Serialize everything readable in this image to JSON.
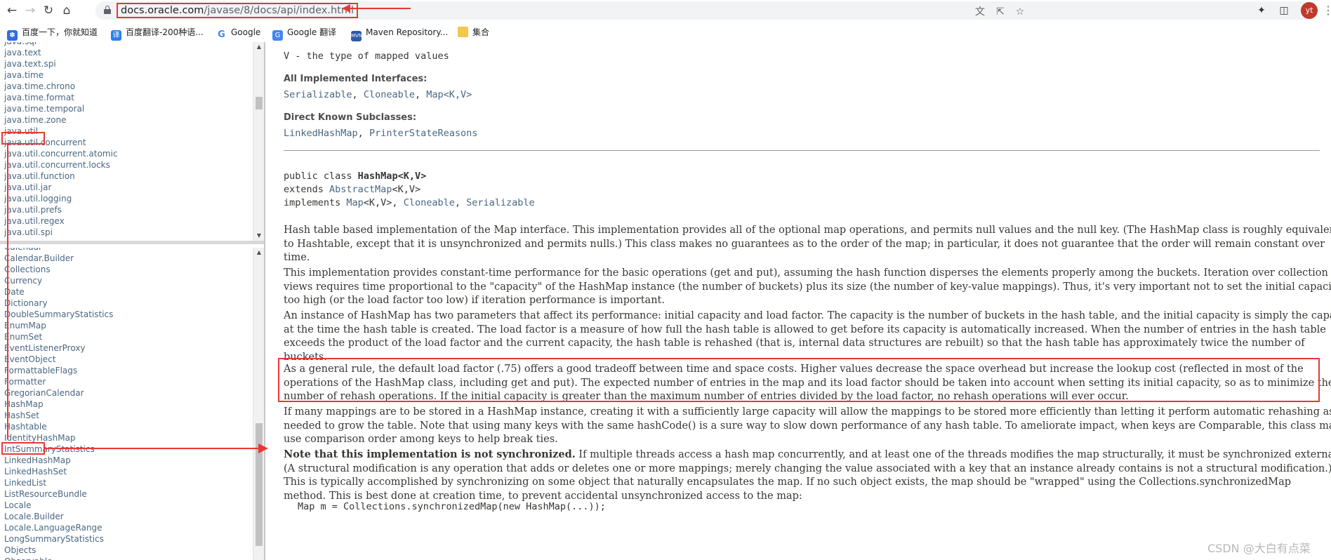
{
  "browser": {
    "url_host": "docs.oracle.com",
    "url_path": "/javase/8/docs/api/index.html",
    "avatar_initials": "yt",
    "bookmarks": [
      {
        "label": "百度一下，你就知道",
        "icon": "baidu-paw-icon",
        "color": "#2b6de6"
      },
      {
        "label": "百度翻译-200种语...",
        "icon": "baidu-translate-icon",
        "color": "#2b7ef0"
      },
      {
        "label": "Google",
        "icon": "google-g-icon",
        "color": "#4285f4"
      },
      {
        "label": "Google 翻译",
        "icon": "google-translate-icon",
        "color": "#4285f4"
      },
      {
        "label": "Maven Repository...",
        "icon": "mvn-icon",
        "color": "#2f5aa8"
      },
      {
        "label": "集合",
        "icon": "folder-icon",
        "color": "#f3c74b"
      }
    ]
  },
  "packages_frame": {
    "items": [
      "java.sql",
      "java.text",
      "java.text.spi",
      "java.time",
      "java.time.chrono",
      "java.time.format",
      "java.time.temporal",
      "java.time.zone",
      "java.util",
      "java.util.concurrent",
      "java.util.concurrent.atomic",
      "java.util.concurrent.locks",
      "java.util.function",
      "java.util.jar",
      "java.util.logging",
      "java.util.prefs",
      "java.util.regex",
      "java.util.spi"
    ],
    "highlighted": "java.util"
  },
  "classes_frame": {
    "items": [
      "Calendar",
      "Calendar.Builder",
      "Collections",
      "Currency",
      "Date",
      "Dictionary",
      "DoubleSummaryStatistics",
      "EnumMap",
      "EnumSet",
      "EventListenerProxy",
      "EventObject",
      "FormattableFlags",
      "Formatter",
      "GregorianCalendar",
      "HashMap",
      "HashSet",
      "Hashtable",
      "IdentityHashMap",
      "IntSummaryStatistics",
      "LinkedHashMap",
      "LinkedHashSet",
      "LinkedList",
      "ListResourceBundle",
      "Locale",
      "Locale.Builder",
      "Locale.LanguageRange",
      "LongSummaryStatistics",
      "Objects",
      "Observable"
    ],
    "highlighted": "HashMap"
  },
  "doc": {
    "type_param": "V - the type of mapped values",
    "impl_label": "All Implemented Interfaces:",
    "impl_links": [
      "Serializable",
      "Cloneable",
      "Map<K,V>"
    ],
    "subclasses_label": "Direct Known Subclasses:",
    "subclass_links": [
      "LinkedHashMap",
      "PrinterStateReasons"
    ],
    "decl_line1_pre": "public class ",
    "decl_line1_name": "HashMap<K,V>",
    "decl_line2_pre": "extends ",
    "decl_line2_link": "AbstractMap",
    "decl_line2_post": "<K,V>",
    "decl_line3_pre": "implements ",
    "decl_line3_link1": "Map",
    "decl_line3_mid1": "<K,V>, ",
    "decl_line3_link2": "Cloneable",
    "decl_line3_mid2": ", ",
    "decl_line3_link3": "Serializable",
    "p1_lines": [
      "Hash table based implementation of the Map interface. This implementation provides all of the optional map operations, and permits null values and the null key. (The HashMap class is roughly equivalent",
      "to Hashtable, except that it is unsynchronized and permits nulls.) This class makes no guarantees as to the order of the map; in particular, it does not guarantee that the order will remain constant over",
      "time."
    ],
    "p2_lines": [
      "This implementation provides constant-time performance for the basic operations (get and put), assuming the hash function disperses the elements properly among the buckets. Iteration over collection",
      "views requires time proportional to the \"capacity\" of the HashMap instance (the number of buckets) plus its size (the number of key-value mappings). Thus, it's very important not to set the initial capacity",
      "too high (or the load factor too low) if iteration performance is important."
    ],
    "p3_lines": [
      "An instance of HashMap has two parameters that affect its performance: initial capacity and load factor. The capacity is the number of buckets in the hash table, and the initial capacity is simply the capacity",
      "at the time the hash table is created. The load factor is a measure of how full the hash table is allowed to get before its capacity is automatically increased. When the number of entries in the hash table",
      "exceeds the product of the load factor and the current capacity, the hash table is rehashed (that is, internal data structures are rebuilt) so that the hash table has approximately twice the number of",
      "buckets."
    ],
    "p4_lines": [
      "As a general rule, the default load factor (.75) offers a good tradeoff between time and space costs. Higher values decrease the space overhead but increase the lookup cost (reflected in most of the",
      "operations of the HashMap class, including get and put). The expected number of entries in the map and its load factor should be taken into account when setting its initial capacity, so as to minimize the",
      "number of rehash operations. If the initial capacity is greater than the maximum number of entries divided by the load factor, no rehash operations will ever occur."
    ],
    "p5_lines": [
      "If many mappings are to be stored in a HashMap instance, creating it with a sufficiently large capacity will allow the mappings to be stored more efficiently than letting it perform automatic rehashing as",
      "needed to grow the table. Note that using many keys with the same hashCode() is a sure way to slow down performance of any hash table. To ameliorate impact, when keys are Comparable, this class may",
      "use comparison order among keys to help break ties."
    ],
    "p6_bold": "Note that this implementation is not synchronized.",
    "p6_lines": [
      " If multiple threads access a hash map concurrently, and at least one of the threads modifies the map structurally, it must be synchronized externally.",
      "(A structural modification is any operation that adds or deletes one or more mappings; merely changing the value associated with a key that an instance already contains is not a structural modification.)",
      "This is typically accomplished by synchronizing on some object that naturally encapsulates the map. If no such object exists, the map should be \"wrapped\" using the Collections.synchronizedMap",
      "method. This is best done at creation time, to prevent accidental unsynchronized access to the map:"
    ],
    "code_line": "Map m = Collections.synchronizedMap(new HashMap(...));"
  },
  "watermark": "CSDN @大白有点菜",
  "colors": {
    "annotation_red": "#e53935",
    "link": "#4a6782",
    "text": "#353833"
  }
}
